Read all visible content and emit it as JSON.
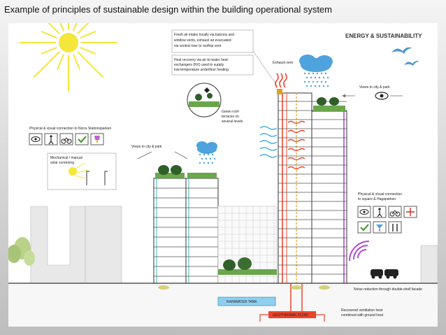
{
  "slide_title": "Example of principles of sustainable design within the building operational system",
  "header": "ENERGY & SUSTAINABILITY",
  "callouts": {
    "fresh_air": [
      "Fresh air intake locally via balcony and",
      "window vents, exhaust air evacuated",
      "via central riser to rooftop vent"
    ],
    "heat_recovery": [
      "Heat recovery via air-to-water heat-",
      "exchangers (HX) used to supply",
      "low-temperature underfloor heating"
    ],
    "exhaust_vent": "Exhaust vent",
    "green_roof": [
      "Green roof-",
      "terraces on",
      "several levels"
    ],
    "views_left": "Views to city & park",
    "views_right": "Views to city & park",
    "physical_left": "Physical & visual connection to Norra Stationsparken",
    "mechanical": [
      "Mechanical / manual",
      "solar screening"
    ],
    "physical_right": [
      "Physical & visual connection",
      "to square & Hagaparken"
    ],
    "noise": "Noise reduction through double-shell facade",
    "rainwater": "RAINWATER TANK",
    "geo": "GEOTHERMAL FLOW",
    "recovered": [
      "Recovered ventilation heat",
      "combined with ground heat"
    ]
  },
  "icons_left": [
    "eye-icon",
    "walk-icon",
    "bike-icon",
    "check-icon",
    "trophy-icon"
  ],
  "icons_right": [
    "eye-icon",
    "walk-icon",
    "bike-icon",
    "arrows-icon",
    "check-icon",
    "cocktail-icon",
    "cutlery-icon"
  ],
  "colors": {
    "sun": "#f5e63a",
    "rain": "#4ea3dc",
    "wind": "#4ab0e0",
    "heat": "#e8452c",
    "vent": "#e0a020",
    "green": "#6aa64a",
    "purple": "#b04ad0",
    "tank": "#8fd0f0"
  }
}
